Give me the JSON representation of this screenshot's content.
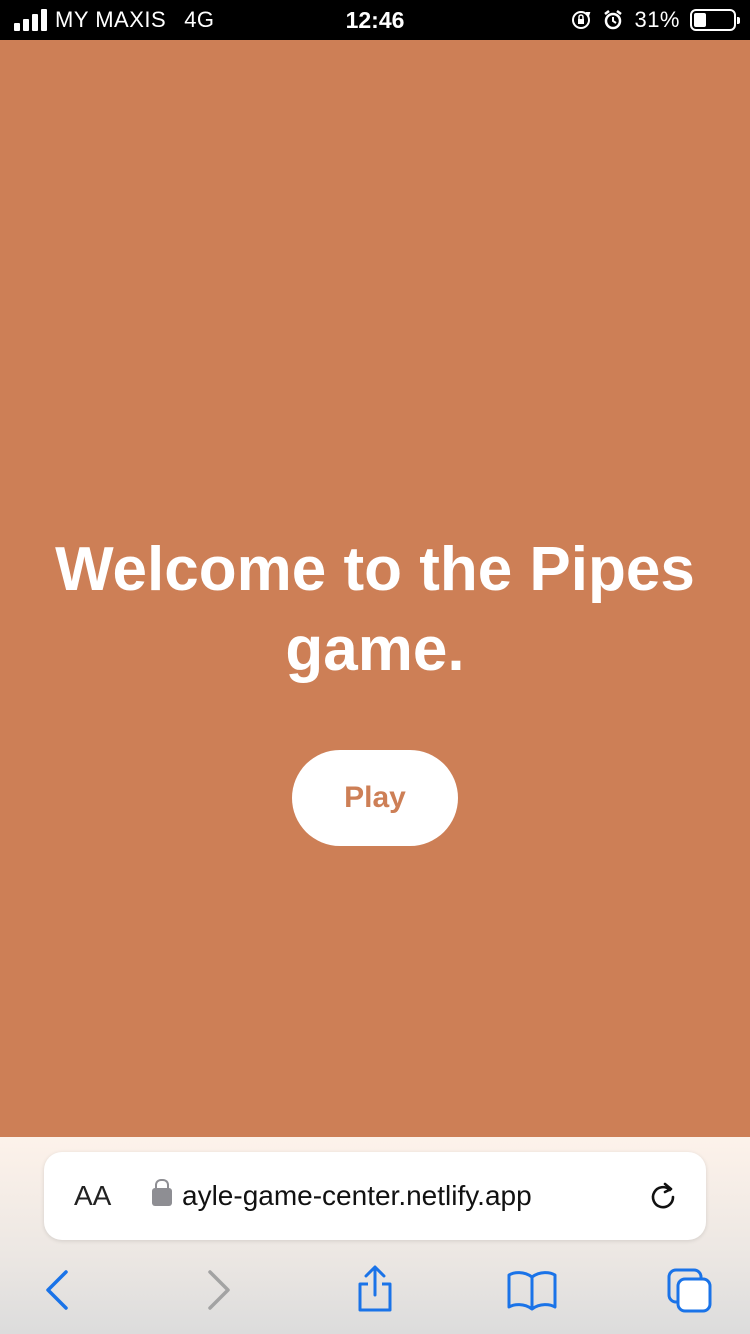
{
  "status_bar": {
    "carrier": "MY MAXIS",
    "network": "4G",
    "time": "12:46",
    "battery_percent_label": "31%",
    "battery_level": 0.31,
    "icons": [
      "signal-icon",
      "orientation-lock-icon",
      "alarm-icon",
      "battery-icon"
    ]
  },
  "main": {
    "headline": "Welcome to the Pipes game.",
    "play_label": "Play",
    "background_color": "#cd7f56"
  },
  "browser": {
    "text_size_label": "AA",
    "url": "ayle-game-center.netlify.app",
    "toolbar": [
      "back-icon",
      "forward-icon",
      "share-icon",
      "bookmarks-icon",
      "tabs-icon"
    ],
    "accent_color": "#1a73e8"
  }
}
